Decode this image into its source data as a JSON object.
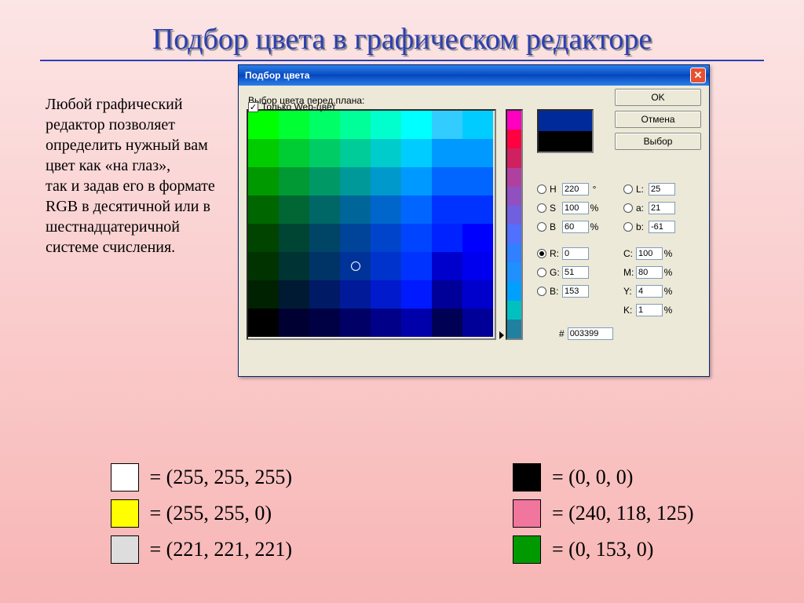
{
  "slide": {
    "title": "Подбор цвета в графическом редакторе",
    "body": "Любой графический редактор позволяет определить нужный вам цвет как «на глаз»,\nтак и задав его в формате\nRGB в десятичной или в шестнадцатеричной системе счисления."
  },
  "dialog": {
    "title": "Подбор цвета",
    "prompt": "Выбор цвета перед.плана:",
    "buttons": {
      "ok": "OK",
      "cancel": "Отмена",
      "select": "Выбор"
    },
    "preview": {
      "top": "#002a99",
      "bottom": "#000000"
    },
    "fields": {
      "H": "220",
      "H_unit": "°",
      "L": "25",
      "S": "100",
      "S_unit": "%",
      "a": "21",
      "Bv": "60",
      "Bv_unit": "%",
      "b": "-61",
      "R": "0",
      "C": "100",
      "C_unit": "%",
      "G": "51",
      "M": "80",
      "M_unit": "%",
      "B": "153",
      "Y": "4",
      "Y_unit": "%",
      "K": "1",
      "K_unit": "%",
      "hex_label": "#",
      "hex": "003399"
    },
    "webonly": {
      "label": "Только Web-цвет",
      "checked": "✓"
    }
  },
  "palette_rows": [
    [
      "#00ff00",
      "#00ff33",
      "#00ff66",
      "#00ff99",
      "#00ffcc",
      "#00ffff",
      "#33ccff",
      "#00ccff"
    ],
    [
      "#00cc00",
      "#00cc33",
      "#00cc66",
      "#00cc99",
      "#00cccc",
      "#00ccff",
      "#0099ff",
      "#0099ff"
    ],
    [
      "#009900",
      "#009933",
      "#009966",
      "#009999",
      "#0099cc",
      "#0099ff",
      "#0066ff",
      "#0066ff"
    ],
    [
      "#006600",
      "#006633",
      "#006666",
      "#006699",
      "#0066cc",
      "#0066ff",
      "#0033ff",
      "#0033ff"
    ],
    [
      "#004400",
      "#004433",
      "#004466",
      "#004499",
      "#0044cc",
      "#0044ff",
      "#0022ff",
      "#0000ff"
    ],
    [
      "#003300",
      "#003333",
      "#003366",
      "#003399",
      "#0033cc",
      "#0033ff",
      "#0000cc",
      "#0000ee"
    ],
    [
      "#002200",
      "#001a33",
      "#001a66",
      "#001a99",
      "#001acc",
      "#001aff",
      "#000099",
      "#0000cc"
    ],
    [
      "#000000",
      "#000033",
      "#000044",
      "#000066",
      "#000088",
      "#0000aa",
      "#000055",
      "#000099"
    ]
  ],
  "picker_ring": {
    "row": 5,
    "col": 3
  },
  "hue_strip": [
    "#ff00c0",
    "#ff0040",
    "#d02060",
    "#b040a0",
    "#9050c0",
    "#7060e0",
    "#5070ff",
    "#3080ff",
    "#2090ff",
    "#00a0ff",
    "#00c0c0",
    "#2080a0"
  ],
  "legend": {
    "left": [
      {
        "color": "#ffffff",
        "text": "= (255, 255, 255)"
      },
      {
        "color": "#ffff00",
        "text": "= (255, 255, 0)"
      },
      {
        "color": "#dddddd",
        "text": "= (221, 221, 221)"
      }
    ],
    "right": [
      {
        "color": "#000000",
        "text": "= (0, 0, 0)"
      },
      {
        "color": "#f0769d",
        "text": "= (240, 118, 125)"
      },
      {
        "color": "#009900",
        "text": "= (0, 153, 0)"
      }
    ]
  }
}
